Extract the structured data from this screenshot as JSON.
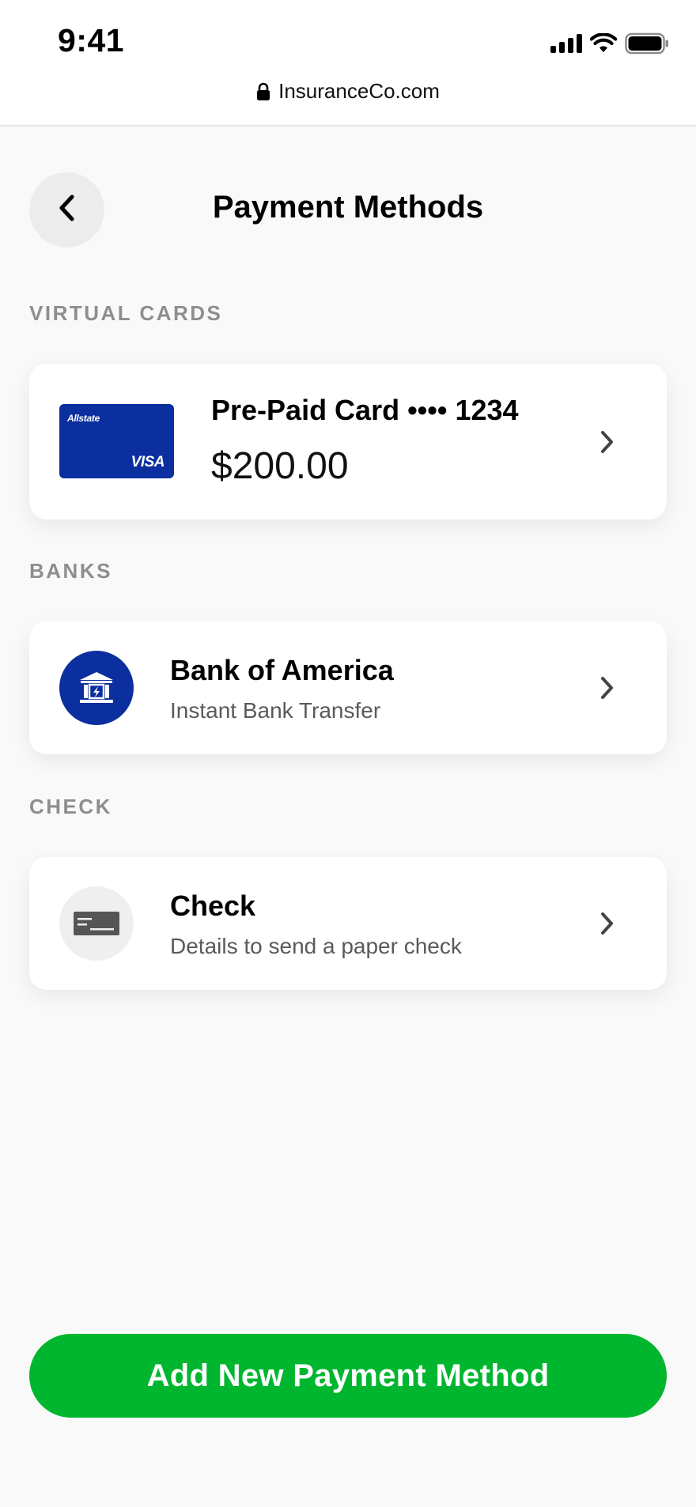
{
  "status_bar": {
    "time": "9:41",
    "icons": [
      "signal-icon",
      "wifi-icon",
      "battery-icon"
    ]
  },
  "browser": {
    "url": "InsuranceCo.com",
    "lock_icon": "lock-icon"
  },
  "header": {
    "title": "Payment Methods",
    "back_icon": "chevron-left-icon"
  },
  "sections": {
    "virtual_cards": {
      "label": "VIRTUAL CARDS",
      "item": {
        "title": "Pre-Paid Card •••• 1234",
        "amount": "$200.00",
        "card_brand": "Allstate",
        "card_network": "VISA",
        "card_color": "#0b2f9e"
      }
    },
    "banks": {
      "label": "BANKS",
      "item": {
        "title": "Bank of America",
        "subtitle": "Instant Bank Transfer",
        "icon": "bank-icon",
        "icon_bg": "#0b2f9e"
      }
    },
    "check": {
      "label": "CHECK",
      "item": {
        "title": "Check",
        "subtitle": "Details to send a paper check",
        "icon": "check-icon",
        "icon_bg": "#efefef"
      }
    }
  },
  "primary_action": {
    "label": "Add New Payment Method",
    "color": "#00b62f"
  }
}
